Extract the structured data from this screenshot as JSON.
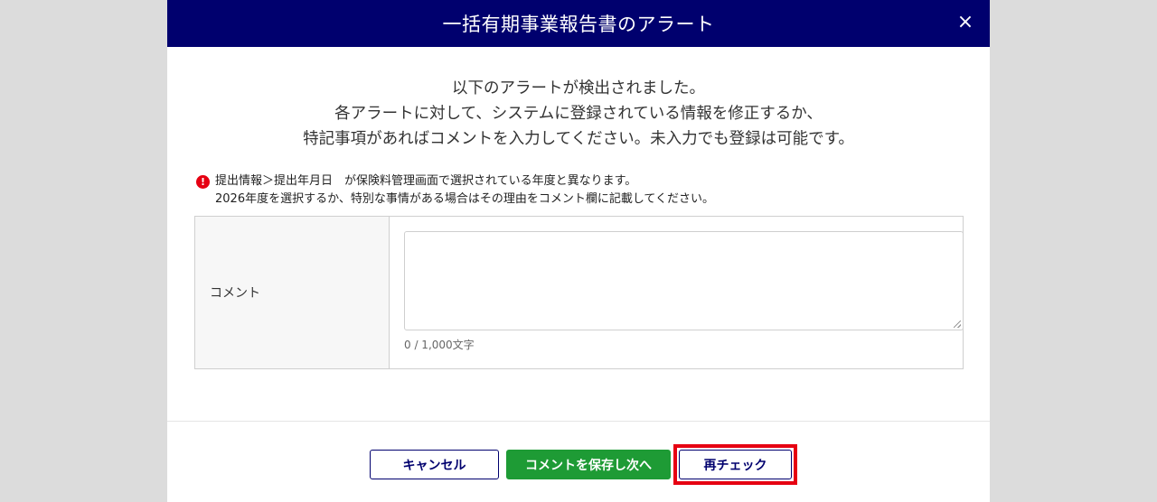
{
  "dialog": {
    "title": "一括有期事業報告書のアラート",
    "close_label": "×"
  },
  "intro": {
    "line1": "以下のアラートが検出されました。",
    "line2": "各アラートに対して、システムに登録されている情報を修正するか、",
    "line3": "特記事項があればコメントを入力してください。未入力でも登録は可能です。"
  },
  "alert": {
    "icon_glyph": "!",
    "icon_name": "error-icon",
    "line1": "提出情報＞提出年月日　が保険料管理画面で選択されている年度と異なります。",
    "line2": "2026年度を選択するか、特別な事情がある場合はその理由をコメント欄に記載してください。"
  },
  "comment": {
    "label": "コメント",
    "value": "",
    "char_count": "0 / 1,000文字"
  },
  "buttons": {
    "cancel": "キャンセル",
    "save_next": "コメントを保存し次へ",
    "recheck": "再チェック"
  },
  "colors": {
    "header_bg": "#00006e",
    "save_button": "#1e9b35",
    "highlight": "#e60012",
    "alert_icon": "#e60012"
  }
}
